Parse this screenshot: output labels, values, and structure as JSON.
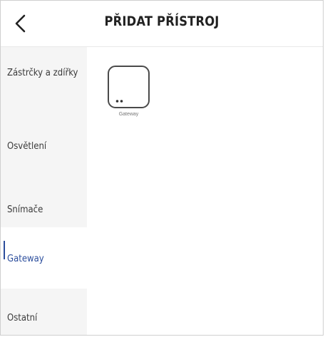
{
  "header": {
    "title": "PŘIDAT PŘÍSTROJ",
    "back_icon": "chevron-left-icon"
  },
  "sidebar": {
    "items": [
      {
        "label": "Zástrčky a zdířky",
        "active": false
      },
      {
        "label": "Osvětlení",
        "active": false
      },
      {
        "label": "Snímače",
        "active": false
      },
      {
        "label": "Gateway",
        "active": true
      },
      {
        "label": "Ostatní",
        "active": false
      }
    ]
  },
  "devices": [
    {
      "label": "Gateway",
      "icon": "gateway-device-icon"
    }
  ],
  "colors": {
    "accent": "#2b4d9c",
    "sidebar_bg": "#f5f5f5",
    "text": "#3a3a3a"
  }
}
